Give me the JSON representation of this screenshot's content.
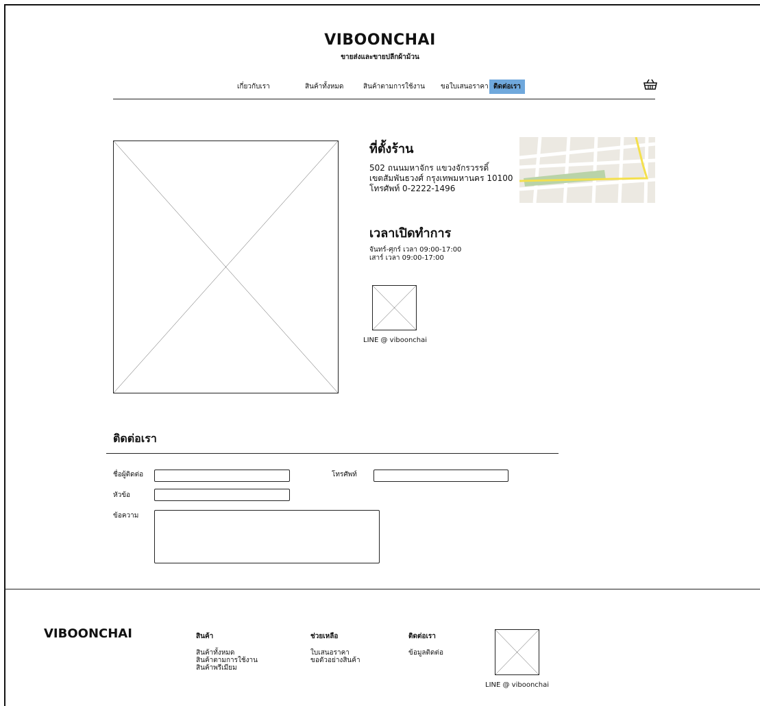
{
  "header": {
    "logo": "VIBOONCHAI",
    "tagline": "ขายส่งและขายปลีกผ้าม้วน",
    "nav": [
      {
        "label": "เกี่ยวกับเรา"
      },
      {
        "label": "สินค้าทั้งหมด"
      },
      {
        "label": "สินค้าตามการใช้งาน"
      },
      {
        "label": "ขอใบเสนอราคา"
      },
      {
        "label": "ติดต่อเรา",
        "active": true
      }
    ],
    "cart_icon": "basket-icon",
    "accent_color": "#6fa8dc"
  },
  "store": {
    "location_title": "ที่ตั้งร้าน",
    "address_line1": "502 ถนนมหาจักร แขวงจักรวรรดิ์",
    "address_line2": "เขตสัมพันธวงศ์ กรุงเทพมหานคร 10100",
    "phone_line": "โทรศัพท์ 0-2222-1496",
    "hours_title": "เวลาเปิดทำการ",
    "hours_line1": "จันทร์-ศุกร์ เวลา 09:00-17:00",
    "hours_line2": "เสาร์ เวลา 09:00-17:00",
    "line_caption": "LINE @ viboonchai"
  },
  "contact_form": {
    "title": "ติดต่อเรา",
    "name_label": "ชื่อผู้ติดต่อ",
    "phone_label": "โทรศัพท์",
    "subject_label": "หัวข้อ",
    "message_label": "ข้อความ",
    "name_value": "",
    "phone_value": "",
    "subject_value": "",
    "message_value": ""
  },
  "footer": {
    "logo": "VIBOONCHAI",
    "columns": [
      {
        "title": "สินค้า",
        "links": [
          "สินค้าทั้งหมด",
          "สินค้าตามการใช้งาน",
          "สินค้าพรีเมียม"
        ]
      },
      {
        "title": "ช่วยเหลือ",
        "links": [
          "ใบเสนอราคา",
          "ขอตัวอย่างสินค้า"
        ]
      },
      {
        "title": "ติดต่อเรา",
        "links": [
          "ข้อมูลติดต่อ"
        ]
      }
    ],
    "line_caption": "LINE @ viboonchai"
  }
}
